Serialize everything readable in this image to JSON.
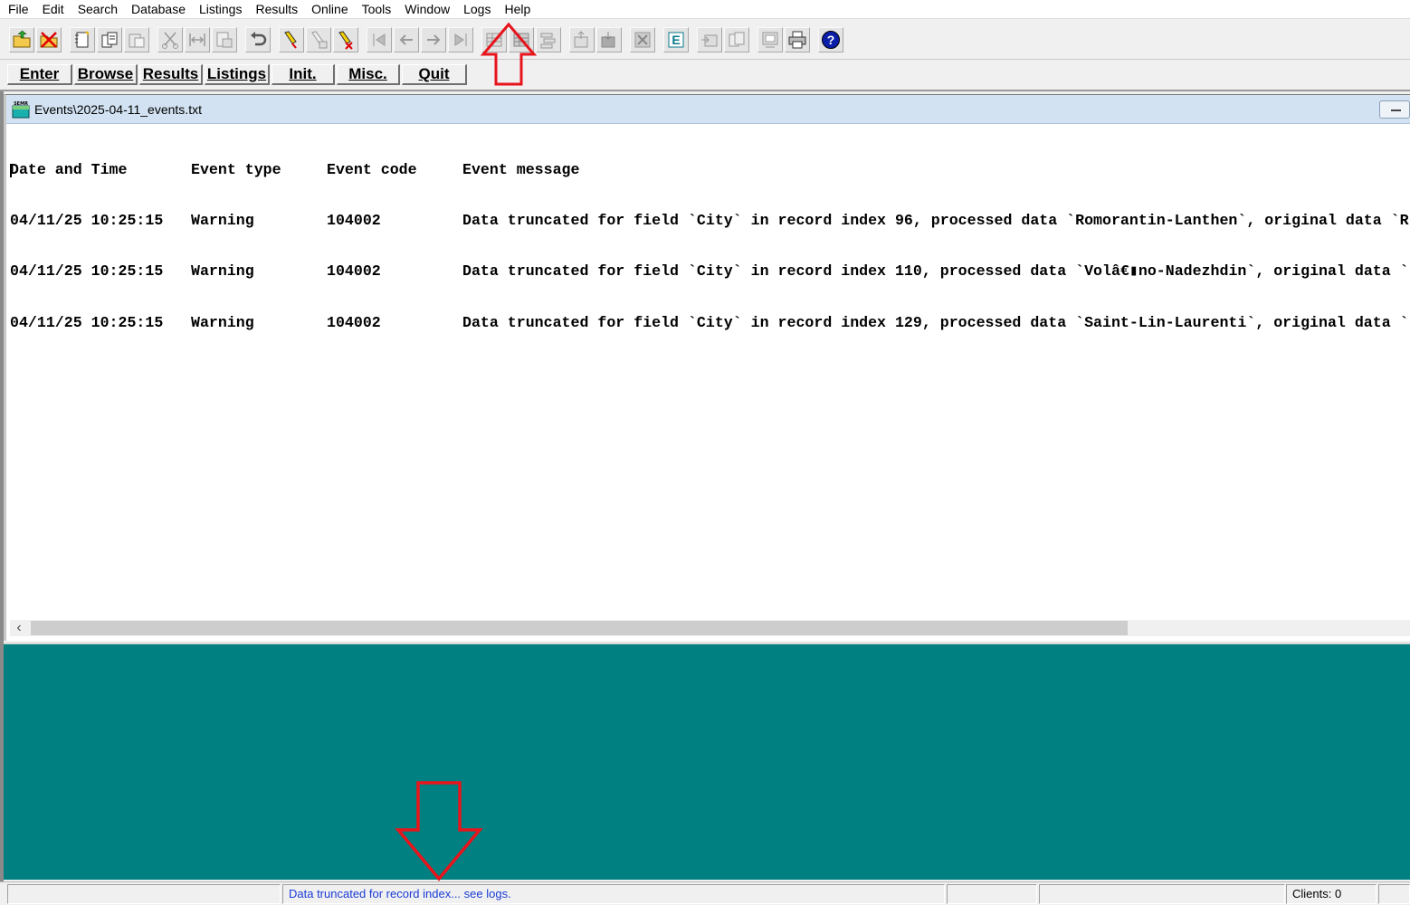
{
  "menu": [
    "File",
    "Edit",
    "Search",
    "Database",
    "Listings",
    "Results",
    "Online",
    "Tools",
    "Window",
    "Logs",
    "Help"
  ],
  "toolbar_icons": [
    "open-folder-icon",
    "close-db-icon",
    "new-record-icon",
    "copy-record-icon",
    "paste-record-icon",
    "cut-icon",
    "move-icon",
    "save-icon",
    "undo-icon",
    "mark-icon",
    "unmark-icon",
    "sort-icon",
    "first-record-icon",
    "prev-record-icon",
    "next-record-icon",
    "last-record-icon",
    "table-icon",
    "table-edit-icon",
    "stack-icon",
    "export-icon",
    "import-icon",
    "delete-icon",
    "edit-e-icon",
    "send-icon",
    "copy-doc-icon",
    "preview-icon",
    "print-icon",
    "help-icon"
  ],
  "commands": {
    "enter": "Enter",
    "browse": "Browse",
    "results": "Results",
    "listings": "Listings",
    "init": "Init.",
    "misc": "Misc.",
    "quit": "Quit"
  },
  "child_window": {
    "title": "Events\\2025-04-11_events.txt",
    "headers": [
      "Date and Time",
      "Event type",
      "Event code",
      "Event message"
    ],
    "rows": [
      [
        "04/11/25 10:25:15",
        "Warning",
        "104002",
        "Data truncated for field `City` in record index 96, processed data `Romorantin-Lanthen`, original data `R"
      ],
      [
        "04/11/25 10:25:15",
        "Warning",
        "104002",
        "Data truncated for field `City` in record index 110, processed data `Volâ€▮no-Nadezhdin`, original data `"
      ],
      [
        "04/11/25 10:25:15",
        "Warning",
        "104002",
        "Data truncated for field `City` in record index 129, processed data `Saint-Lin-Laurenti`, original data `"
      ]
    ]
  },
  "statusbar": {
    "message": "Data truncated for record index... see logs.",
    "clients": "Clients: 0"
  },
  "colors": {
    "mdi_background": "#008080",
    "annotation_arrow": "#e8141c",
    "status_message": "#1a3bd6",
    "child_titlebar": "#d2e2f2"
  }
}
